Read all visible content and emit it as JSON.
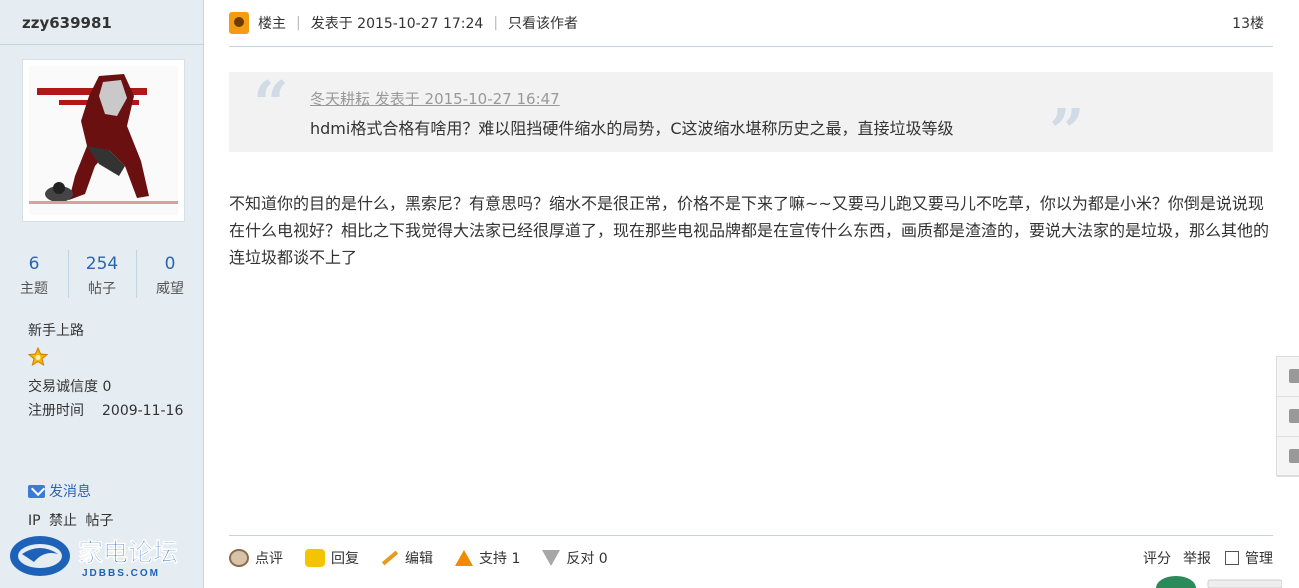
{
  "user": {
    "name": "zzy639981",
    "stats": [
      {
        "num": "6",
        "label": "主题"
      },
      {
        "num": "254",
        "label": "帖子"
      },
      {
        "num": "0",
        "label": "威望"
      }
    ],
    "rank": "新手上路",
    "credit": "交易诚信度 0",
    "reg_label": "注册时间",
    "reg_date": "2009-11-16",
    "message": "发消息",
    "admin": [
      "IP",
      "禁止",
      "帖子"
    ]
  },
  "logo": {
    "main": "家电论坛",
    "sub": "JDBBS.COM"
  },
  "post": {
    "op_label": "楼主",
    "posted": "发表于 2015-10-27 17:24",
    "author_only": "只看该作者",
    "floor": "13楼",
    "quote_author": "冬天耕耘 发表于 2015-10-27 16:47",
    "quote_text": "hdmi格式合格有啥用？难以阻挡硬件缩水的局势，C这波缩水堪称历史之最，直接垃圾等级",
    "body": "不知道你的目的是什么，黑索尼？有意思吗？缩水不是很正常，价格不是下来了嘛~~又要马儿跑又要马儿不吃草，你以为都是小米？你倒是说说现在什么电视好？相比之下我觉得大法家已经很厚道了，现在那些电视品牌都是在宣传什么东西，画质都是渣渣的，要说大法家的是垃圾，那么其他的连垃圾都谈不上了"
  },
  "footer": {
    "comment": "点评",
    "reply": "回复",
    "edit": "编辑",
    "support": "支持 1",
    "oppose": "反对 0",
    "rate": "评分",
    "report": "举报",
    "manage": "管理"
  },
  "colors": {
    "sidebar_bg": "#e5edf2",
    "border": "#c2d5e3",
    "link": "#2d64b3",
    "quote_bg": "#f2f2f2"
  }
}
